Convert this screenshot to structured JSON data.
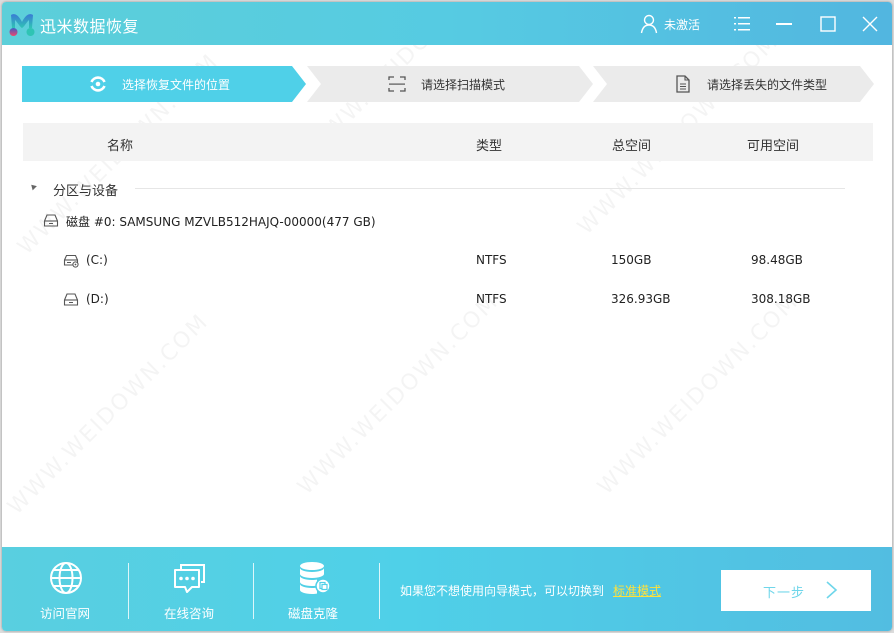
{
  "window": {
    "app_title": "迅米数据恢复",
    "user_status": "未激活",
    "controls": {
      "menu": "menu-icon",
      "minimize": "minimize-icon",
      "maximize": "maximize-icon",
      "close": "close-icon"
    }
  },
  "steps": [
    {
      "label": "选择恢复文件的位置",
      "icon": "location-target-icon",
      "active": true
    },
    {
      "label": "请选择扫描模式",
      "icon": "scan-frame-icon",
      "active": false
    },
    {
      "label": "请选择丢失的文件类型",
      "icon": "document-icon",
      "active": false
    }
  ],
  "table": {
    "columns": [
      "名称",
      "类型",
      "总空间",
      "可用空间"
    ],
    "group": {
      "label": "分区与设备",
      "expanded": true
    },
    "disk": {
      "label": "磁盘 #0: SAMSUNG MZVLB512HAJQ-00000(477 GB)",
      "icon": "hard-disk-icon"
    },
    "partitions": [
      {
        "name": "(C:)",
        "type": "NTFS",
        "total": "150GB",
        "free": "98.48GB",
        "icon": "system-drive-icon"
      },
      {
        "name": "(D:)",
        "type": "NTFS",
        "total": "326.93GB",
        "free": "308.18GB",
        "icon": "drive-icon"
      }
    ]
  },
  "footer": {
    "items": [
      {
        "label": "访问官网",
        "icon": "globe-icon"
      },
      {
        "label": "在线咨询",
        "icon": "chat-bubbles-icon"
      },
      {
        "label": "磁盘克隆",
        "icon": "database-clone-icon"
      }
    ],
    "hint": "如果您不想使用向导模式，可以切换到",
    "standard_mode_link": "标准模式",
    "next_button": "下一步"
  },
  "watermark": "WWW.WEIDOWN.COM",
  "colors": {
    "accent": "#4fd0e8",
    "title_bar": "#56cbe2",
    "step_inactive": "#ebebeb",
    "link": "#ffe23a",
    "next_text": "#6fd6ea"
  }
}
